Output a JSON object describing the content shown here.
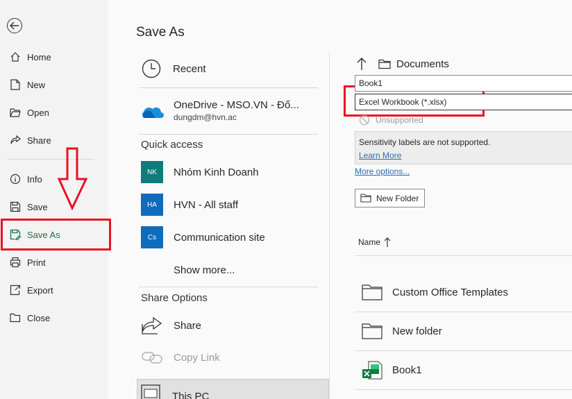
{
  "nav": {
    "items": [
      {
        "label": "Home"
      },
      {
        "label": "New"
      },
      {
        "label": "Open"
      },
      {
        "label": "Share"
      },
      {
        "label": "Info"
      },
      {
        "label": "Save"
      },
      {
        "label": "Save As"
      },
      {
        "label": "Print"
      },
      {
        "label": "Export"
      },
      {
        "label": "Close"
      }
    ],
    "active_color": "#1e7145"
  },
  "page": {
    "title": "Save As"
  },
  "locations": {
    "recent": "Recent",
    "onedrive": {
      "name": "OneDrive - MSO.VN - Đố...",
      "email": "dungdm@hvn.ac"
    },
    "quick_access_label": "Quick access",
    "sites": [
      {
        "initials": "NK",
        "name": "Nhóm Kinh Doanh",
        "color": "#0f7b7b"
      },
      {
        "initials": "HA",
        "name": "HVN - All staff",
        "color": "#0f6cbd"
      },
      {
        "initials": "Cs",
        "name": "Communication site",
        "color": "#0f6cbd"
      }
    ],
    "show_more": "Show more...",
    "share_options_label": "Share Options",
    "share": "Share",
    "copy_link": "Copy Link",
    "this_pc": "This PC"
  },
  "save_panel": {
    "folder": "Documents",
    "filename": "Book1",
    "file_type": "Excel Workbook (*.xlsx)",
    "sensitivity_status": "Unsupported",
    "sensitivity_message": "Sensitivity labels are not supported.",
    "learn_more": "Learn More",
    "more_options": "More options...",
    "new_folder": "New Folder",
    "name_column": "Name",
    "files": [
      {
        "name": "Custom Office Templates",
        "icon": "folder-icon"
      },
      {
        "name": "New folder",
        "icon": "folder-icon"
      },
      {
        "name": "Book1",
        "icon": "excel-file-icon"
      }
    ]
  },
  "annotation_color": "#e81123"
}
